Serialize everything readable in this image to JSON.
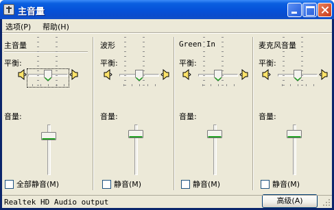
{
  "window": {
    "title": "主音量"
  },
  "menu": [
    {
      "label": "选项(P)"
    },
    {
      "label": "帮助(H)"
    }
  ],
  "balance_label": "平衡:",
  "volume_label": "音量:",
  "channels": [
    {
      "title": "主音量",
      "mute_label": "全部静音(M)",
      "balance": 0.5,
      "volume": 0.82,
      "muted": false
    },
    {
      "title": "波形",
      "mute_label": "静音(M)",
      "balance": 0.5,
      "volume": 0.87,
      "muted": false
    },
    {
      "title": "Green In",
      "mute_label": "静音(M)",
      "balance": 0.5,
      "volume": 0.87,
      "muted": false
    },
    {
      "title": "麦克风音量",
      "mute_label": "静音(M)",
      "balance": 0.5,
      "volume": 0.87,
      "muted": false,
      "advanced_label": "高级(A)"
    }
  ],
  "status": {
    "text": "Realtek HD Audio output"
  },
  "colors": {
    "titlebar": "#0551d8",
    "client": "#ece9d8",
    "thumb_accent": "#21a121"
  }
}
